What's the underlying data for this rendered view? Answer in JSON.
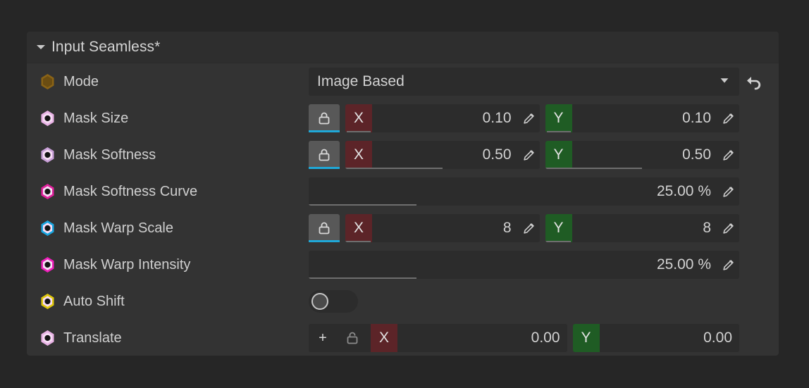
{
  "panel": {
    "header": {
      "title": "Input Seamless*",
      "caret": "chevron-down-icon"
    }
  },
  "colors": {
    "page_bg": "#262626",
    "panel_bg": "#333333",
    "header_bg": "#2e2e2e",
    "field_bg": "#2c2c2c",
    "lock_active_bg": "#585858",
    "lock_underline": "#1fa8d8",
    "axis_x_bg": "#5c2428",
    "axis_y_bg": "#1f5c24",
    "label_text": "#cfcfcf",
    "value_text": "#d2d2d2"
  },
  "rows": [
    {
      "label": "Mode",
      "hex_color": "#8a6316",
      "hex_filled": true,
      "type": "dropdown",
      "value": "Image Based",
      "dropdown_icon": "chevron-down-icon",
      "reset_icon": "undo-arrow-icon"
    },
    {
      "label": "Mask Size",
      "hex_color": "#e9b3e5",
      "hex_filled": false,
      "type": "xy",
      "lock": "closed",
      "x": {
        "badge": "X",
        "value": "0.10",
        "fill_pct": 0
      },
      "y": {
        "badge": "Y",
        "value": "0.10",
        "fill_pct": 0
      },
      "edit_icon": "pencil-icon"
    },
    {
      "label": "Mask Softness",
      "hex_color": "#c9a0d8",
      "hex_filled": false,
      "type": "xy",
      "lock": "closed",
      "x": {
        "badge": "X",
        "value": "0.50",
        "fill_pct": 50
      },
      "y": {
        "badge": "Y",
        "value": "0.50",
        "fill_pct": 50
      },
      "edit_icon": "pencil-icon"
    },
    {
      "label": "Mask Softness Curve",
      "hex_color": "#e0209c",
      "hex_filled": false,
      "type": "single",
      "value": "25.00 %",
      "fill_pct": 25,
      "edit_icon": "pencil-icon"
    },
    {
      "label": "Mask Warp Scale",
      "hex_color": "#18a6e0",
      "hex_filled": false,
      "type": "xy",
      "lock": "closed",
      "x": {
        "badge": "X",
        "value": "8",
        "fill_pct": 13
      },
      "y": {
        "badge": "Y",
        "value": "8",
        "fill_pct": 13
      },
      "edit_icon": "pencil-icon"
    },
    {
      "label": "Mask Warp Intensity",
      "hex_color": "#ef1fbb",
      "hex_filled": false,
      "type": "single",
      "value": "25.00 %",
      "fill_pct": 25,
      "edit_icon": "pencil-icon"
    },
    {
      "label": "Auto Shift",
      "hex_color": "#e0c80c",
      "hex_filled": false,
      "type": "toggle",
      "toggle_on": false
    },
    {
      "label": "Translate",
      "hex_color": "#e9b3e5",
      "hex_filled": false,
      "type": "translate",
      "add_label": "+",
      "lock": "open",
      "x": {
        "badge": "X",
        "value": "0.00"
      },
      "y": {
        "badge": "Y",
        "value": "0.00"
      }
    }
  ]
}
